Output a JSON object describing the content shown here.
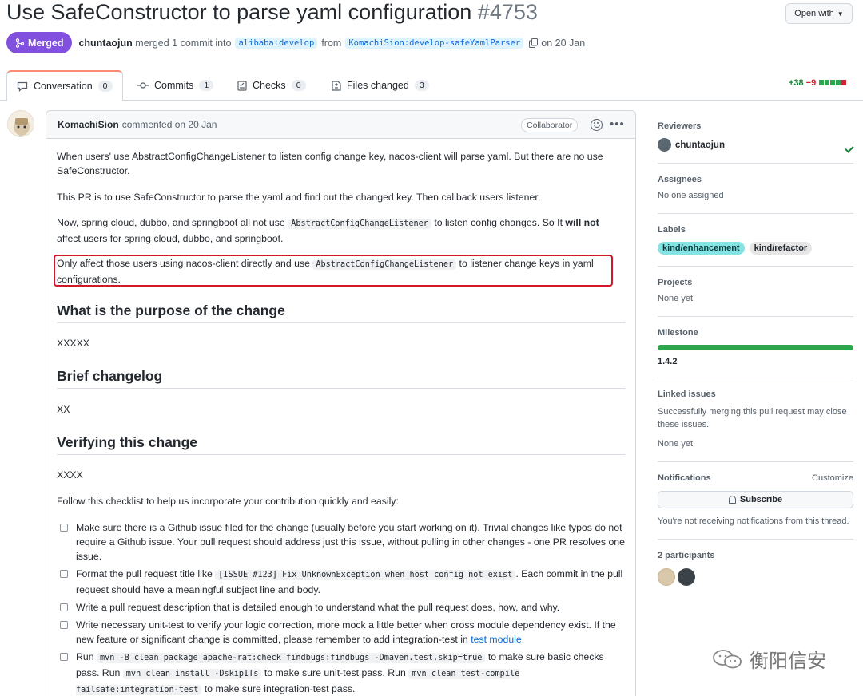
{
  "header": {
    "title": "Use SafeConstructor to parse yaml configuration",
    "number": "#4753",
    "open_with": "Open with",
    "status": "Merged",
    "author": "chuntaojun",
    "merged_text": "merged 1 commit into",
    "base_branch": "alibaba:develop",
    "from_text": "from",
    "head_branch": "KomachiSion:develop-safeYamlParser",
    "date_text": "on 20 Jan"
  },
  "tabs": [
    {
      "label": "Conversation",
      "count": "0"
    },
    {
      "label": "Commits",
      "count": "1"
    },
    {
      "label": "Checks",
      "count": "0"
    },
    {
      "label": "Files changed",
      "count": "3"
    }
  ],
  "diffstat": {
    "added": "+38",
    "removed": "−9"
  },
  "comment": {
    "author": "KomachiSion",
    "meta": "commented on 20 Jan",
    "badge": "Collaborator",
    "p1": "When users' use AbstractConfigChangeListener to listen config change key, nacos-client will parse yaml. But there are no use SafeConstructor.",
    "p2": "This PR is to use SafeConstructor to parse the yaml and find out the changed key. Then callback users listener.",
    "p3a": "Now, spring cloud, dubbo, and springboot all not use",
    "p3code": "AbstractConfigChangeListener",
    "p3b": "to listen config changes. So It",
    "p3bold": "will not",
    "p3c": "affect users for spring cloud, dubbo, and springboot.",
    "p4a": "Only affect those users using nacos-client directly and use",
    "p4code": "AbstractConfigChangeListener",
    "p4b": "to listener change keys in yaml configurations.",
    "h_purpose": "What is the purpose of the change",
    "purpose": "XXXXX",
    "h_changelog": "Brief changelog",
    "changelog": "XX",
    "h_verify": "Verifying this change",
    "verify": "XXXX",
    "checklist_intro": "Follow this checklist to help us incorporate your contribution quickly and easily:",
    "c1": "Make sure there is a Github issue filed for the change (usually before you start working on it). Trivial changes like typos do not require a Github issue. Your pull request should address just this issue, without pulling in other changes - one PR resolves one issue.",
    "c2a": "Format the pull request title like",
    "c2code": "[ISSUE #123] Fix UnknownException when host config not exist",
    "c2b": ". Each commit in the pull request should have a meaningful subject line and body.",
    "c3": "Write a pull request description that is detailed enough to understand what the pull request does, how, and why.",
    "c4a": "Write necessary unit-test to verify your logic correction, more mock a little better when cross module dependency exist. If the new feature or significant change is committed, please remember to add integration-test in",
    "c4link": "test module",
    "c4b": ".",
    "c5a": "Run",
    "c5code1": "mvn -B clean package apache-rat:check findbugs:findbugs -Dmaven.test.skip=true",
    "c5b": "to make sure basic checks pass. Run",
    "c5code2": "mvn clean install -DskipITs",
    "c5c": "to make sure unit-test pass. Run",
    "c5code3": "mvn clean test-compile failsafe:integration-test",
    "c5d": "to make sure integration-test pass."
  },
  "sidebar": {
    "reviewers_title": "Reviewers",
    "reviewer": "chuntaojun",
    "assignees_title": "Assignees",
    "assignees": "No one assigned",
    "labels_title": "Labels",
    "labels": [
      "kind/enhancement",
      "kind/refactor"
    ],
    "projects_title": "Projects",
    "projects": "None yet",
    "milestone_title": "Milestone",
    "milestone": "1.4.2",
    "linked_title": "Linked issues",
    "linked_text": "Successfully merging this pull request may close these issues.",
    "linked_none": "None yet",
    "notifications_title": "Notifications",
    "customize": "Customize",
    "subscribe": "Subscribe",
    "notif_text": "You're not receiving notifications from this thread.",
    "participants_title": "2 participants"
  },
  "watermark": "衡阳信安",
  "colors": {
    "merged": "#8250df",
    "link": "#0969da",
    "highlight": "#d0182b",
    "milestone": "#2da44e"
  }
}
